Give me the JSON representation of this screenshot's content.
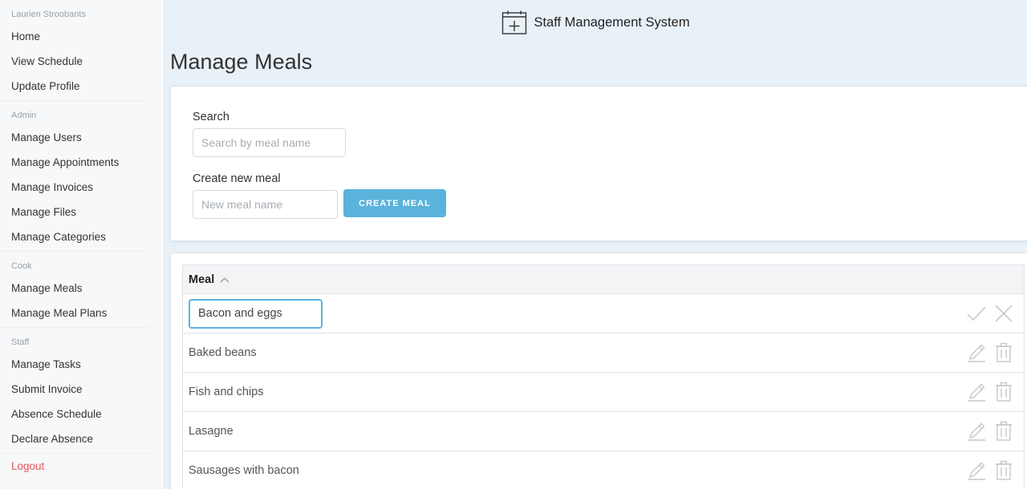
{
  "sidebar": {
    "user_name": "Laurien Stroobants",
    "sections": [
      {
        "header": "",
        "items": [
          "Home",
          "View Schedule",
          "Update Profile"
        ]
      },
      {
        "header": "Admin",
        "items": [
          "Manage Users",
          "Manage Appointments",
          "Manage Invoices",
          "Manage Files",
          "Manage Categories"
        ]
      },
      {
        "header": "Cook",
        "items": [
          "Manage Meals",
          "Manage Meal Plans"
        ]
      },
      {
        "header": "Staff",
        "items": [
          "Manage Tasks",
          "Submit Invoice",
          "Absence Schedule",
          "Declare Absence"
        ]
      }
    ],
    "logout": "Logout"
  },
  "header": {
    "app_title": "Staff Management System"
  },
  "page": {
    "title": "Manage Meals"
  },
  "form": {
    "search_label": "Search",
    "search_placeholder": "Search by meal name",
    "create_label": "Create new meal",
    "create_placeholder": "New meal name",
    "create_button": "CREATE MEAL"
  },
  "table": {
    "column": "Meal",
    "editing_value": "Bacon and eggs",
    "rows": [
      "Baked beans",
      "Fish and chips",
      "Lasagne",
      "Sausages with bacon"
    ]
  },
  "colors": {
    "accent": "#5ab3db",
    "logout": "#e05757",
    "page_bg": "#e9f1f8"
  }
}
